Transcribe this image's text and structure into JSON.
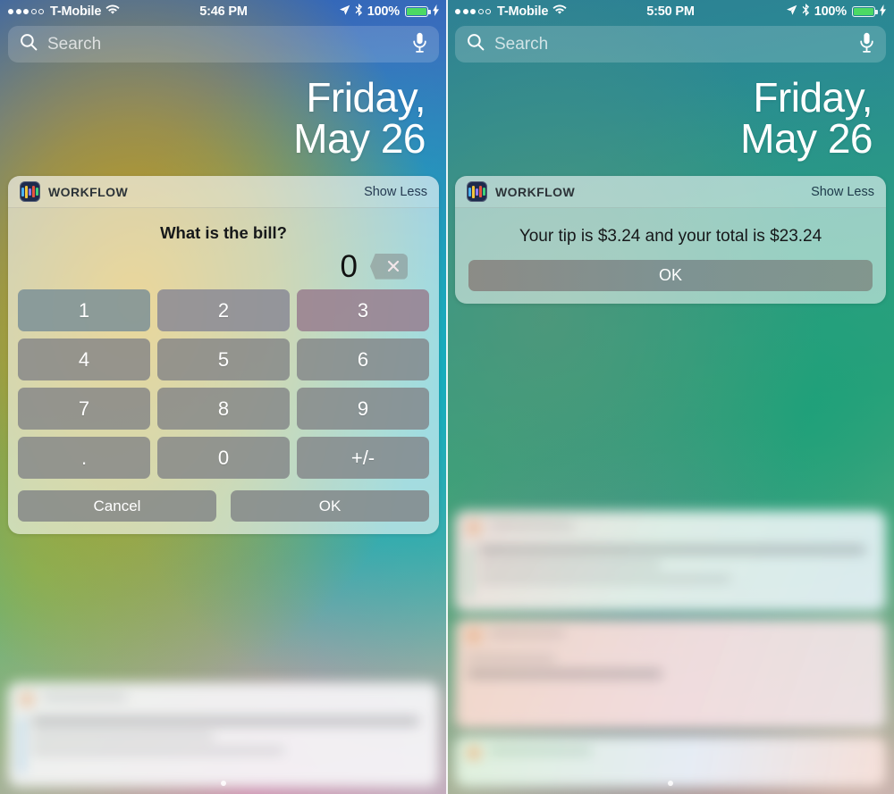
{
  "panels": [
    {
      "id": "left",
      "status": {
        "carrier": "T-Mobile",
        "signal_filled": 3,
        "signal_total": 5,
        "wifi_icon": "wifi-icon",
        "time": "5:46 PM",
        "location_icon": "location-arrow-icon",
        "bluetooth_icon": "bluetooth-icon",
        "battery_percent": "100%",
        "battery_color": "#4cd964",
        "charging_icon": "lightning-bolt-icon"
      },
      "search": {
        "placeholder": "Search",
        "search_icon": "search-icon",
        "mic_icon": "microphone-icon"
      },
      "date": {
        "line1": "Friday,",
        "line2": "May 26"
      },
      "widget": {
        "app_icon": "workflow-app-icon",
        "title": "WORKFLOW",
        "toggle_label": "Show Less",
        "question": "What is the bill?",
        "value": "0",
        "delete_icon": "backspace-delete-icon",
        "keys": [
          "1",
          "2",
          "3",
          "4",
          "5",
          "6",
          "7",
          "8",
          "9",
          ".",
          "0",
          "+/-"
        ],
        "cancel_label": "Cancel",
        "ok_label": "OK"
      }
    },
    {
      "id": "right",
      "status": {
        "carrier": "T-Mobile",
        "signal_filled": 3,
        "signal_total": 5,
        "wifi_icon": "wifi-icon",
        "time": "5:50 PM",
        "location_icon": "location-arrow-icon",
        "bluetooth_icon": "bluetooth-icon",
        "battery_percent": "100%",
        "battery_color": "#4cd964",
        "charging_icon": "lightning-bolt-icon"
      },
      "search": {
        "placeholder": "Search",
        "search_icon": "search-icon",
        "mic_icon": "microphone-icon"
      },
      "date": {
        "line1": "Friday,",
        "line2": "May 26"
      },
      "widget": {
        "app_icon": "workflow-app-icon",
        "title": "WORKFLOW",
        "toggle_label": "Show Less",
        "result_text": "Your tip is $3.24 and your total is $23.24",
        "ok_label": "OK"
      }
    }
  ],
  "icon_colors": {
    "workflow_bars": [
      "#4ab3f4",
      "#f2c53d",
      "#8e7cf0",
      "#e8563f",
      "#3fd07a"
    ],
    "workflow_background": "#1e2b4d"
  }
}
